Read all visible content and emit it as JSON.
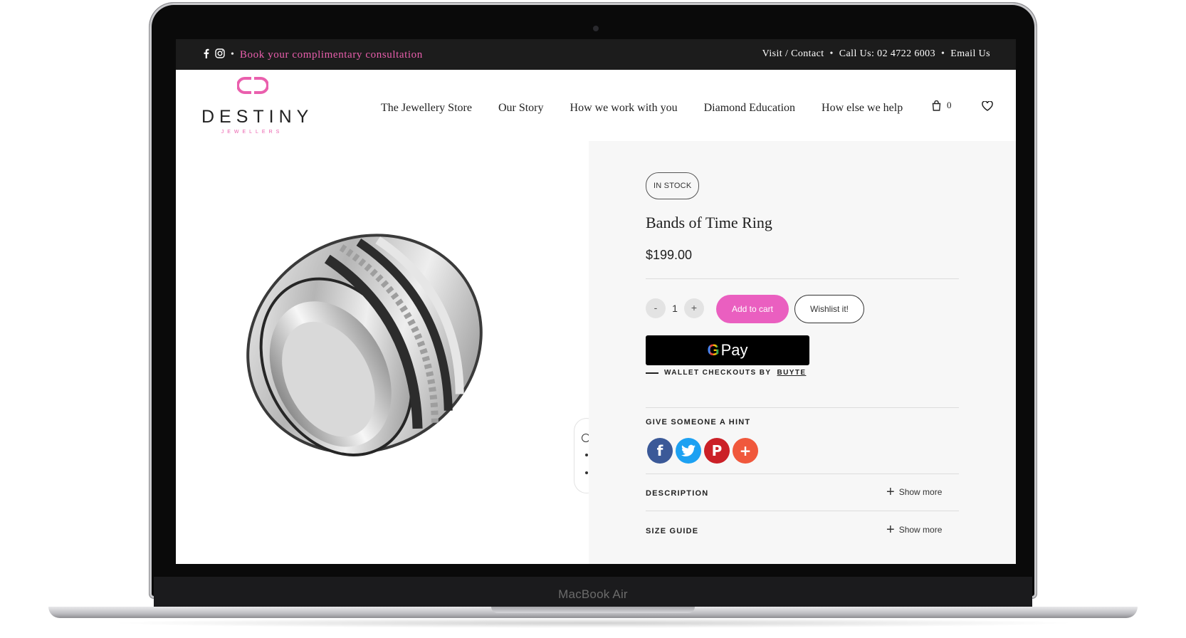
{
  "device": {
    "label": "MacBook Air"
  },
  "topbar": {
    "facebook_icon": "facebook-icon",
    "instagram_icon": "instagram-icon",
    "bullet": "•",
    "consultation": "Book your complimentary consultation",
    "links": [
      {
        "label": "Visit / Contact"
      },
      {
        "label": "Call Us: 02 4722 6003"
      },
      {
        "label": "Email Us"
      }
    ],
    "accent_color": "#ea5fad"
  },
  "brand": {
    "name": "DESTINY",
    "sub": "JEWELLERS",
    "color": "#ea5fad"
  },
  "nav": {
    "items": [
      {
        "label": "The Jewellery Store"
      },
      {
        "label": "Our Story"
      },
      {
        "label": "How we work with you"
      },
      {
        "label": "Diamond Education"
      },
      {
        "label": "How else we help"
      }
    ],
    "cart_count": "0",
    "cart_icon": "shopping-bag-icon",
    "wishlist_icon": "heart-icon"
  },
  "product": {
    "stock_badge": "IN STOCK",
    "title": "Bands of Time Ring",
    "price": "$199.00",
    "qty_minus": "-",
    "qty": "1",
    "qty_plus": "+",
    "add_to_cart": "Add to cart",
    "wishlist": "Wishlist it!",
    "gpay_g": "G",
    "gpay_label": "Pay",
    "wallet_text": "WALLET CHECKOUTS BY",
    "wallet_brand": "BUYTE",
    "hint_title": "GIVE SOMEONE A HINT",
    "share": [
      {
        "name": "facebook",
        "glyph": "f",
        "color": "#3b5998"
      },
      {
        "name": "twitter",
        "glyph": "t",
        "color": "#1da1f2"
      },
      {
        "name": "pinterest",
        "glyph": "P",
        "color": "#cb2027"
      },
      {
        "name": "more",
        "glyph": "+",
        "color": "#f0583c"
      }
    ],
    "accordions": [
      {
        "label": "DESCRIPTION",
        "action": "Show more"
      },
      {
        "label": "SIZE GUIDE",
        "action": "Show more"
      }
    ],
    "accent_color": "#ea5fc0"
  }
}
